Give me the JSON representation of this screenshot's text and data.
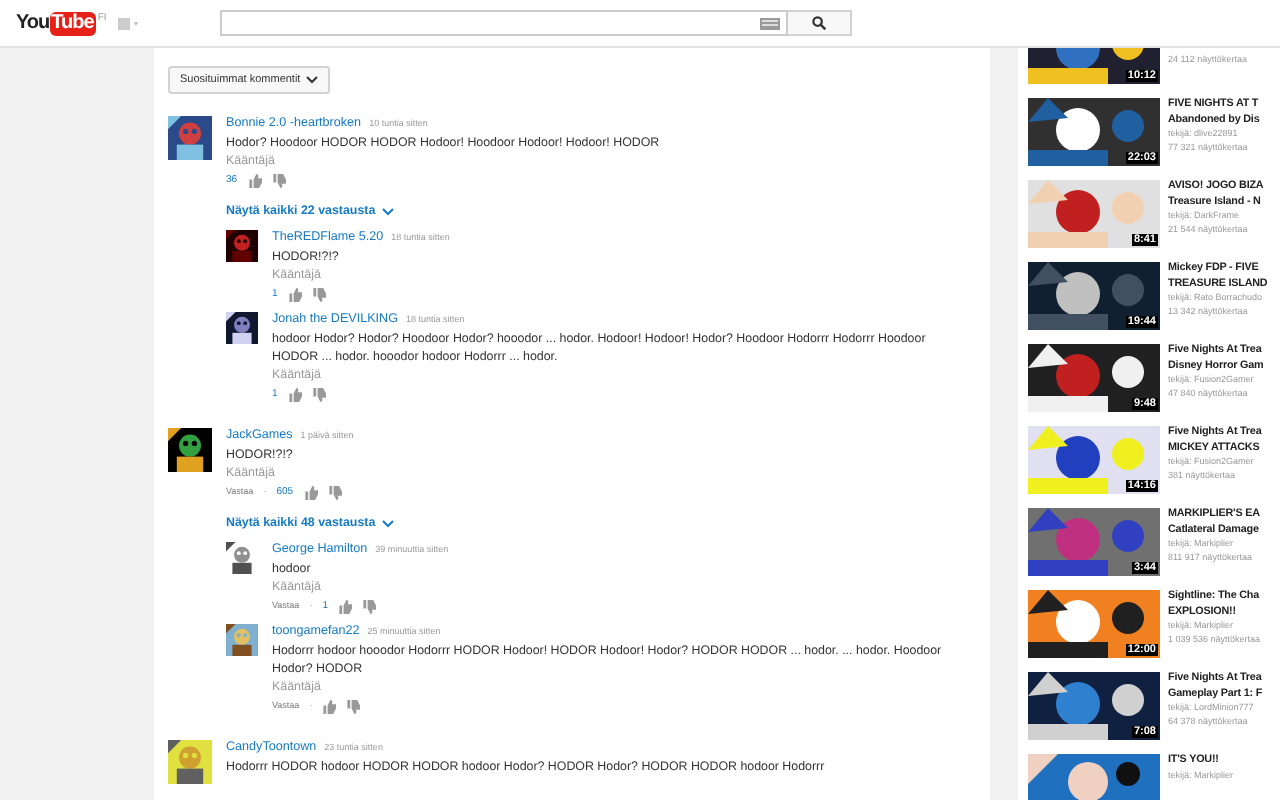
{
  "header": {
    "logo_you": "You",
    "logo_tube": "Tube",
    "region": "FI"
  },
  "sort_menu": {
    "label": "Suosituimmat kommentit"
  },
  "comments": [
    {
      "author": "Bonnie 2.0 -heartbroken",
      "time": "10 tuntia sitten",
      "text": "Hodor? Hoodoor HODOR HODOR Hodoor! Hoodoor Hodoor! Hodoor! HODOR",
      "translate": "Kääntäjä",
      "likes": "36",
      "show_replies": "Näytä kaikki 22 vastausta",
      "replies": [
        {
          "author": "TheREDFlame 5.20",
          "time": "18 tuntia sitten",
          "text": "HODOR!?!?",
          "translate": "Kääntäjä",
          "likes": "1"
        },
        {
          "author": "Jonah the DEVILKING",
          "time": "18 tuntia sitten",
          "text": "hodoor Hodor? Hodor? Hoodoor Hodor? hooodor ... hodor. Hodoor! Hodoor! Hodor? Hoodoor Hodorrr Hodorrr Hoodoor HODOR ... hodor. hooodor hodoor Hodorrr ... hodor.",
          "translate": "Kääntäjä",
          "likes": "1"
        }
      ]
    },
    {
      "author": "JackGames",
      "time": "1 päivä sitten",
      "text": "HODOR!?!?",
      "translate": "Kääntäjä",
      "reply": "Vastaa",
      "separator": "·",
      "likes": "605",
      "show_replies": "Näytä kaikki 48 vastausta",
      "replies": [
        {
          "author": "George Hamilton",
          "time": "39 minuuttia sitten",
          "text": "hodoor",
          "translate": "Kääntäjä",
          "reply": "Vastaa",
          "separator": "·",
          "likes": "1"
        },
        {
          "author": "toongamefan22",
          "time": "25 minuuttia sitten",
          "text": "Hodorrr hodoor hooodor Hodorrr HODOR Hodoor! HODOR Hodoor! Hodor? HODOR HODOR ... hodor. ... hodor. Hoodoor Hodor? HODOR",
          "translate": "Kääntäjä",
          "reply": "Vastaa",
          "separator": "·"
        }
      ]
    },
    {
      "author": "CandyToontown",
      "time": "23 tuntia sitten",
      "text": "Hodorrr HODOR hodoor HODOR HODOR hodoor Hodor? HODOR Hodor? HODOR HODOR hodoor Hodorrr"
    }
  ],
  "sidebar": [
    {
      "views": "24 112 näyttökertaa",
      "duration": "10:12",
      "cut": true
    },
    {
      "title_lines": [
        "FIVE NIGHTS AT T",
        "Abandoned by Dis"
      ],
      "channel": "tekijä: dlive22891",
      "views": "77 321 näyttökertaa",
      "duration": "22:03"
    },
    {
      "title_lines": [
        "AVISO! JOGO BIZA",
        "Treasure Island - N"
      ],
      "channel": "tekijä: DarkFrame",
      "views": "21 544 näyttökertaa",
      "duration": "8:41"
    },
    {
      "title_lines": [
        "Mickey FDP - FIVE",
        "TREASURE ISLAND"
      ],
      "channel": "tekijä: Rato Borrachudo",
      "views": "13 342 näyttökertaa",
      "duration": "19:44"
    },
    {
      "title_lines": [
        "Five Nights At Trea",
        "Disney Horror Gam"
      ],
      "channel": "tekijä: Fusion2Gamer",
      "views": "47 840 näyttökertaa",
      "duration": "9:48"
    },
    {
      "title_lines": [
        "Five Nights At Trea",
        "MICKEY ATTACKS"
      ],
      "channel": "tekijä: Fusion2Gamer",
      "views": "381 näyttökertaa",
      "duration": "14:16"
    },
    {
      "title_lines": [
        "MARKIPLIER'S EA",
        "Catlateral Damage"
      ],
      "channel": "tekijä: Markiplier",
      "views": "811 917 näyttökertaa",
      "duration": "3:44"
    },
    {
      "title_lines": [
        "Sightline: The Cha",
        "EXPLOSION!!"
      ],
      "channel": "tekijä: Markiplier",
      "views": "1 039 536 näyttökertaa",
      "duration": "12:00"
    },
    {
      "title_lines": [
        "Five Nights At Trea",
        "Gameplay Part 1: F"
      ],
      "channel": "tekijä: LordMinion777",
      "views": "64 378 näyttökertaa",
      "duration": "7:08"
    },
    {
      "title_lines": [
        "IT'S YOU!!"
      ],
      "channel": "tekijä: Markiplier"
    }
  ]
}
